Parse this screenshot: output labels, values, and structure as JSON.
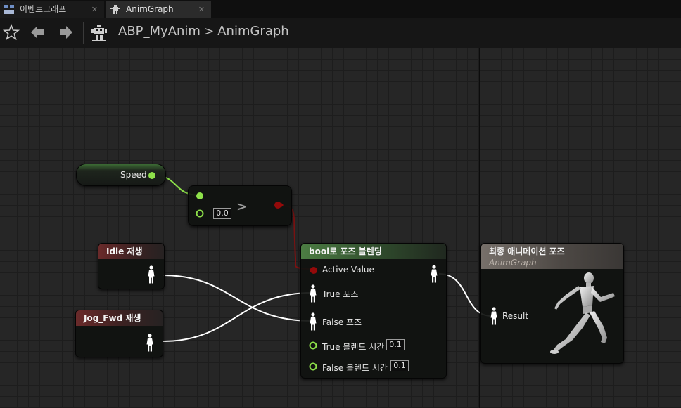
{
  "tabs": [
    {
      "label": "이벤트그래프",
      "icon": "event-graph-icon",
      "active": false
    },
    {
      "label": "AnimGraph",
      "icon": "anim-graph-icon",
      "active": true
    }
  ],
  "toolbar": {
    "breadcrumb": [
      "ABP_MyAnim",
      "AnimGraph"
    ],
    "separator": ">"
  },
  "nodes": {
    "speed": {
      "label": "Speed"
    },
    "compare": {
      "input_value": "0.0",
      "operator": ">"
    },
    "idle": {
      "title": "Idle 재생"
    },
    "jog": {
      "title": "Jog_Fwd 재생"
    },
    "blend": {
      "title": "bool로 포즈 블렌딩",
      "active_value": "Active Value",
      "true_pose": "True 포즈",
      "false_pose": "False 포즈",
      "true_blend_time_label": "True 블렌드 시간",
      "true_blend_time_value": "0.1",
      "false_blend_time_label": "False 블렌드 시간",
      "false_blend_time_value": "0.1"
    },
    "output": {
      "title": "최종 애니메이션 포즈",
      "subtitle": "AnimGraph",
      "result": "Result"
    }
  },
  "colors": {
    "float_pin": "#8ee14a",
    "bool_pin": "#940a0a",
    "pose_wire": "#ffffff",
    "float_wire": "#8ee14a",
    "bool_wire": "#7a1212"
  }
}
